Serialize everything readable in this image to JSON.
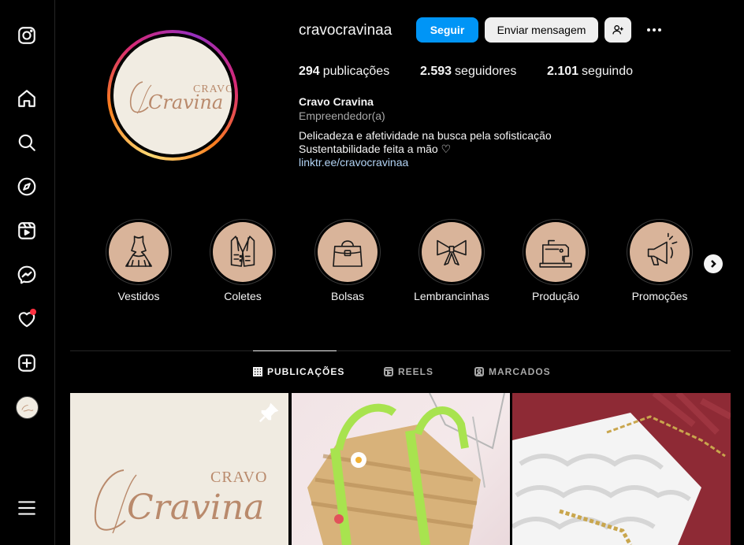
{
  "sidebar": {
    "icons": [
      "instagram-icon",
      "home-icon",
      "search-icon",
      "explore-icon",
      "reels-icon",
      "messenger-icon",
      "notifications-icon",
      "create-icon",
      "profile-avatar",
      "menu-icon"
    ]
  },
  "profile": {
    "username": "cravocravinaa",
    "follow_label": "Seguir",
    "message_label": "Enviar mensagem",
    "posts_count": "294",
    "posts_label": "publicações",
    "followers_count": "2.593",
    "followers_label": "seguidores",
    "following_count": "2.101",
    "following_label": "seguindo",
    "full_name": "Cravo Cravina",
    "category": "Empreendedor(a)",
    "bio_line1": "Delicadeza e afetividade na busca pela sofisticação",
    "bio_line2": "Sustentabilidade feita a mão ♡",
    "link": "linktr.ee/cravocravinaa",
    "logo_word_top": "CRAVO",
    "logo_word_script": "Cravina"
  },
  "highlights": [
    {
      "label": "Vestidos",
      "icon": "dress-icon"
    },
    {
      "label": "Coletes",
      "icon": "vest-icon"
    },
    {
      "label": "Bolsas",
      "icon": "bag-icon"
    },
    {
      "label": "Lembrancinhas",
      "icon": "bow-icon"
    },
    {
      "label": "Produção",
      "icon": "sewing-machine-icon"
    },
    {
      "label": "Promoções",
      "icon": "megaphone-icon"
    }
  ],
  "tabs": [
    {
      "label": "PUBLICAÇÕES",
      "active": true
    },
    {
      "label": "REELS",
      "active": false
    },
    {
      "label": "MARCADOS",
      "active": false
    }
  ],
  "posts": [
    {
      "kind": "logo",
      "pinned": true
    },
    {
      "kind": "straw-bag-photo"
    },
    {
      "kind": "white-crochet-bag-photo"
    }
  ],
  "colors": {
    "accent": "#0095f6",
    "highlight_bg": "#d9b49a",
    "logo_text": "#b98a6c",
    "notification": "#ff3040"
  }
}
